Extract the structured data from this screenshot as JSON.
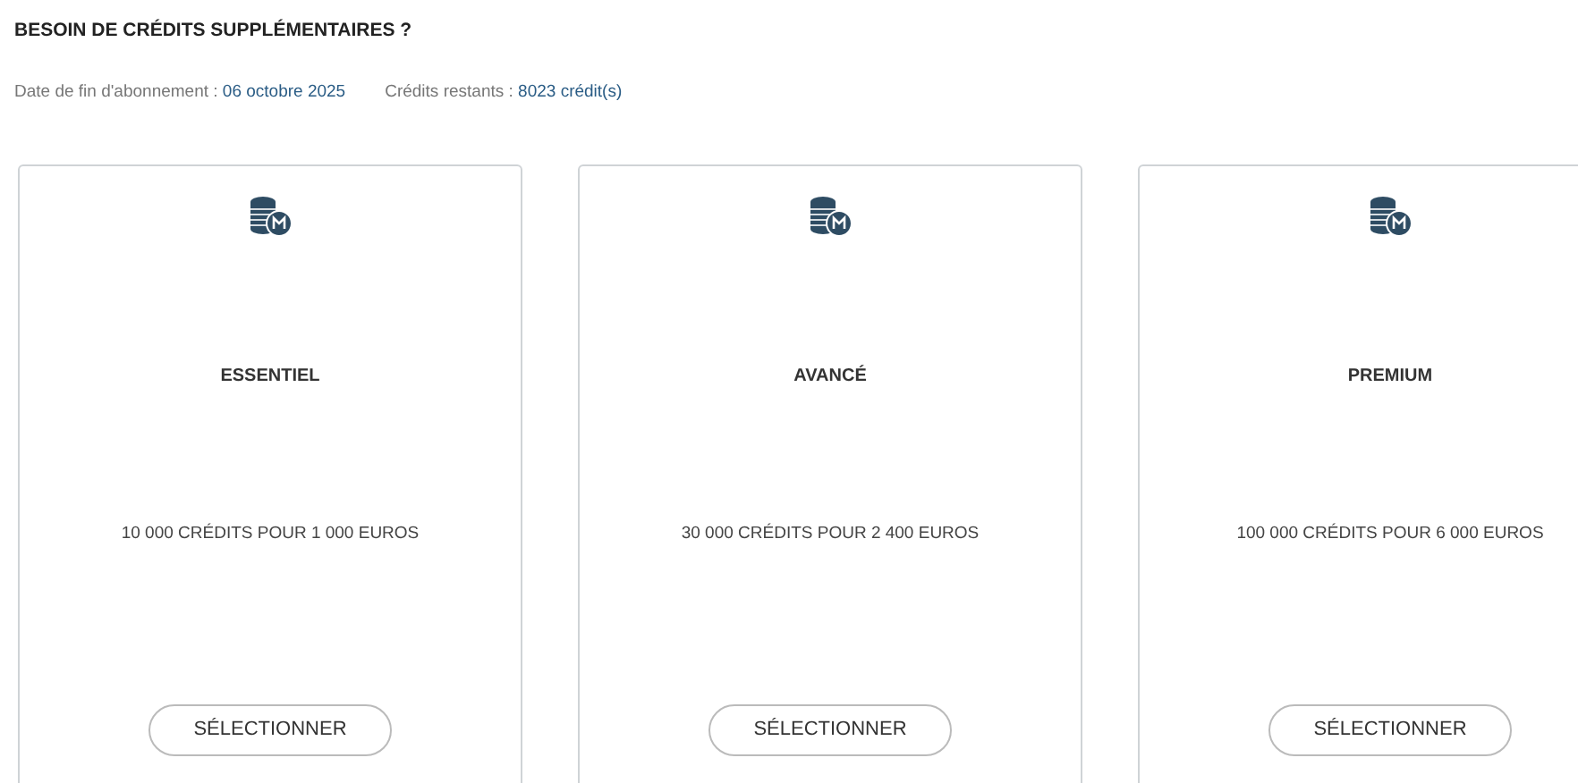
{
  "heading": "BESOIN DE CRÉDITS SUPPLÉMENTAIRES ?",
  "info": [
    {
      "label": "Date de fin d'abonnement :",
      "value": "06 octobre 2025"
    },
    {
      "label": "Crédits restants :",
      "value": "8023 crédit(s)"
    }
  ],
  "plans": [
    {
      "name": "ESSENTIEL",
      "offer": "10 000 CRÉDITS POUR 1 000 EUROS",
      "button": "SÉLECTIONNER"
    },
    {
      "name": "AVANCÉ",
      "offer": "30 000 CRÉDITS POUR 2 400 EUROS",
      "button": "SÉLECTIONNER"
    },
    {
      "name": "PREMIUM",
      "offer": "100 000 CRÉDITS POUR 6 000 EUROS",
      "button": "SÉLECTIONNER"
    }
  ]
}
